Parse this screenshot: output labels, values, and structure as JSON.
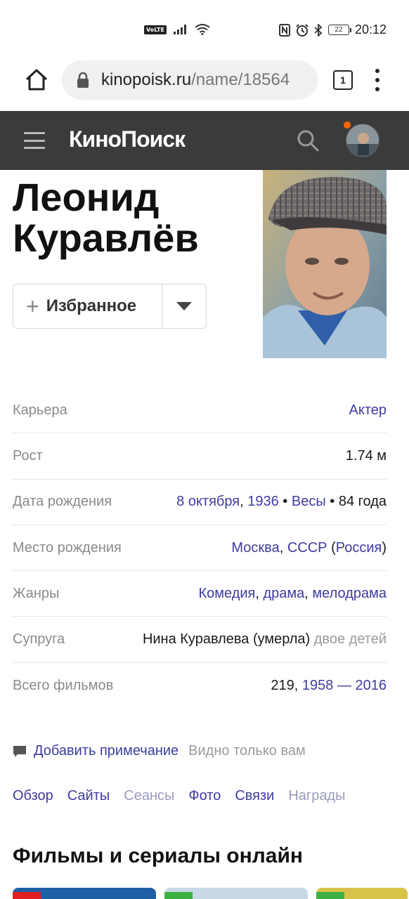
{
  "status_bar": {
    "volte": "VoLTE",
    "signal_icon": "signal-icon",
    "wifi_icon": "wifi-icon",
    "nfc_icon": "nfc-icon",
    "alarm_icon": "alarm-icon",
    "bluetooth_icon": "bluetooth-icon",
    "battery": "22",
    "time": "20:12"
  },
  "browser": {
    "url_domain": "kinopoisk.ru",
    "url_path": "/name/18564",
    "tabs_count": "1"
  },
  "header": {
    "logo": "КиноПоиск"
  },
  "person": {
    "name_line1": "Леонид",
    "name_line2": "Куравлёв",
    "favorite_label": "Избранное"
  },
  "info": {
    "career": {
      "label": "Карьера",
      "value": "Актер"
    },
    "height": {
      "label": "Рост",
      "value": "1.74 м"
    },
    "birth_date": {
      "label": "Дата рождения",
      "day_month": "8 октября",
      "comma": ",",
      "year": "1936",
      "sep1": "•",
      "zodiac": "Весы",
      "sep2": "•",
      "age": "84 года"
    },
    "birth_place": {
      "label": "Место рождения",
      "city": "Москва",
      "comma": ",",
      "country_old": "СССР",
      "open_paren": "(",
      "country": "Россия",
      "close_paren": ")"
    },
    "genres": {
      "label": "Жанры",
      "g1": "Комедия",
      "c1": ",",
      "g2": "драма",
      "c2": ",",
      "g3": "мелодрама"
    },
    "spouse": {
      "label": "Супруга",
      "name": "Нина Куравлева (умерла)",
      "children": "двое детей"
    },
    "total_films": {
      "label": "Всего фильмов",
      "count": "219,",
      "from": "1958",
      "dash": "—",
      "to": "2016"
    }
  },
  "note": {
    "link": "Добавить примечание",
    "hint": "Видно только вам"
  },
  "subnav": [
    "Обзор",
    "Сайты",
    "Сеансы",
    "Фото",
    "Связи",
    "Награды"
  ],
  "section": {
    "title": "Фильмы и сериалы онлайн"
  },
  "colors": {
    "link": "#3c3ca0",
    "header_bg": "#3b3b3b",
    "accent_orange": "#ff6600"
  }
}
